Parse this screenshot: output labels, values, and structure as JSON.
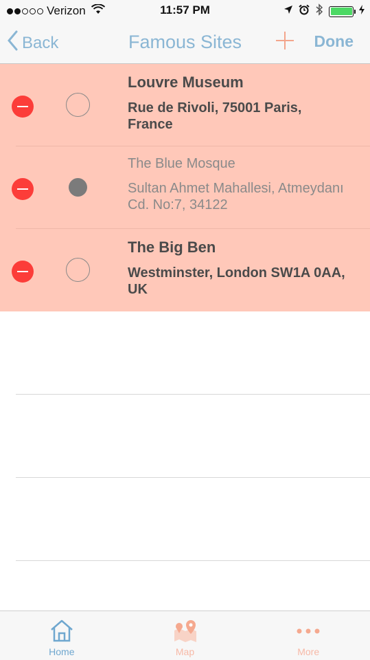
{
  "status_bar": {
    "carrier": "Verizon",
    "time": "11:57 PM",
    "signal_bars_filled": 2,
    "signal_bars_total": 5,
    "battery_level": 1.0,
    "icons": [
      "wifi-icon",
      "location-arrow-icon",
      "alarm-icon",
      "bluetooth-icon",
      "battery-icon",
      "charging-icon"
    ]
  },
  "nav": {
    "back_label": "Back",
    "title": "Famous Sites",
    "done_label": "Done",
    "add_icon": "plus-icon"
  },
  "rows": [
    {
      "title": "Louvre Museum",
      "address": "Rue de Rivoli, 75001 Paris, France",
      "selected": true,
      "radio_filled": false
    },
    {
      "title": "The Blue Mosque",
      "address": "Sultan Ahmet Mahallesi, Atmeydanı Cd. No:7, 34122",
      "selected": true,
      "radio_filled": true
    },
    {
      "title": "The Big Ben",
      "address": "Westminster, London SW1A 0AA, UK",
      "selected": true,
      "radio_filled": false
    }
  ],
  "tabs": [
    {
      "label": "Home",
      "icon": "home-icon",
      "active": true
    },
    {
      "label": "Map",
      "icon": "map-pin-icon",
      "active": false
    },
    {
      "label": "More",
      "icon": "more-dots-icon",
      "active": false
    }
  ],
  "colors": {
    "accent_blue": "#8ab6d4",
    "row_highlight": "#ffc8b9",
    "delete_red": "#fc3d39",
    "tab_inactive": "#f7b9a7"
  }
}
